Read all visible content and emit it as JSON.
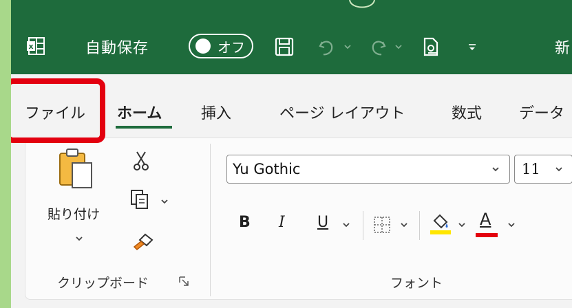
{
  "titlebar": {
    "autosave_label": "自動保存",
    "autosave_state": "オフ",
    "title_partial": "新"
  },
  "tabs": [
    {
      "label": "ファイル"
    },
    {
      "label": "ホーム"
    },
    {
      "label": "挿入"
    },
    {
      "label": "ページ レイアウト"
    },
    {
      "label": "数式"
    },
    {
      "label": "データ"
    }
  ],
  "ribbon": {
    "paste_label": "貼り付け",
    "clipboard_group": "クリップボード",
    "font_group": "フォント",
    "font_name": "Yu Gothic",
    "font_size": "11",
    "bold": "B",
    "italic": "I",
    "underline": "U",
    "font_color_glyph": "A"
  },
  "colors": {
    "brand": "#1e6b3c",
    "highlight": "#e3000f",
    "fill_color": "#ffe600",
    "font_color": "#e3000f"
  }
}
